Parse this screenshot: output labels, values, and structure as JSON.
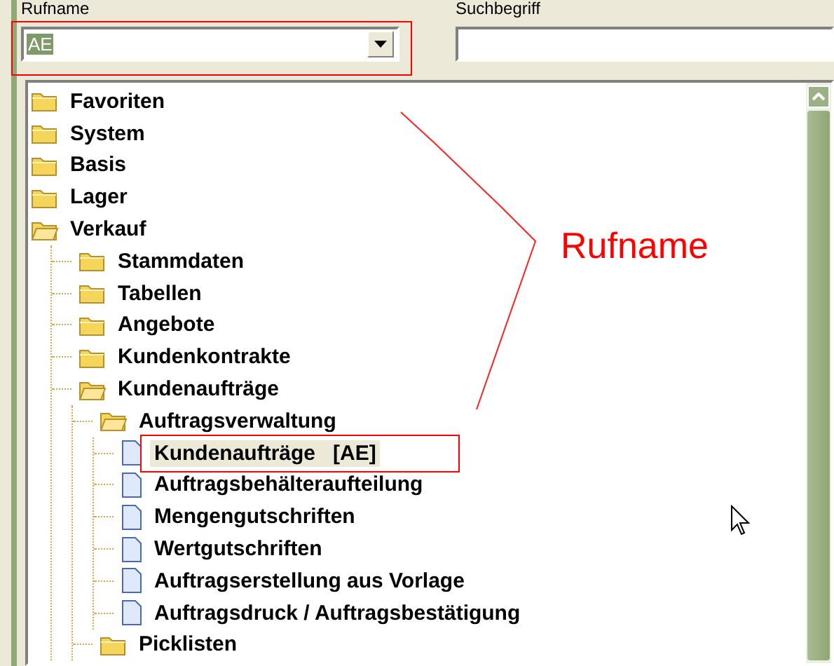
{
  "fields": [
    {
      "kind": "combo",
      "label": "Rufname",
      "value": "AE"
    },
    {
      "kind": "text",
      "label": "Suchbegriff"
    }
  ],
  "tree": [
    {
      "label": "Favoriten",
      "kind": "folder",
      "expanded": false,
      "selected": false
    },
    {
      "label": "System",
      "kind": "folder",
      "expanded": false,
      "selected": false
    },
    {
      "label": "Basis",
      "kind": "folder",
      "expanded": false,
      "selected": false
    },
    {
      "label": "Lager",
      "kind": "folder",
      "expanded": false,
      "selected": false
    },
    {
      "label": "Verkauf",
      "kind": "folder",
      "expanded": true,
      "selected": false,
      "children": [
        {
          "label": "Stammdaten",
          "kind": "folder",
          "expanded": false,
          "selected": false
        },
        {
          "label": "Tabellen",
          "kind": "folder",
          "expanded": false,
          "selected": false
        },
        {
          "label": "Angebote",
          "kind": "folder",
          "expanded": false,
          "selected": false
        },
        {
          "label": "Kundenkontrakte",
          "kind": "folder",
          "expanded": false,
          "selected": false
        },
        {
          "label": "Kundenaufträge",
          "kind": "folder",
          "expanded": true,
          "selected": false,
          "children": [
            {
              "label": "Auftragsverwaltung",
              "kind": "folder",
              "expanded": true,
              "selected": false,
              "children": [
                {
                  "label": "Kundenaufträge   [AE]",
                  "kind": "document",
                  "selected": true
                },
                {
                  "label": "Auftragsbehälteraufteilung",
                  "kind": "document",
                  "selected": false
                },
                {
                  "label": "Mengengutschriften",
                  "kind": "document",
                  "selected": false
                },
                {
                  "label": "Wertgutschriften",
                  "kind": "document",
                  "selected": false
                },
                {
                  "label": "Auftragserstellung aus Vorlage",
                  "kind": "document",
                  "selected": false
                },
                {
                  "label": "Auftragsdruck / Auftragsbestätigung",
                  "kind": "document",
                  "selected": false
                }
              ]
            },
            {
              "label": "Picklisten",
              "kind": "folder",
              "expanded": false,
              "selected": false
            }
          ]
        }
      ]
    }
  ],
  "annotation": {
    "label": "Rufname"
  }
}
